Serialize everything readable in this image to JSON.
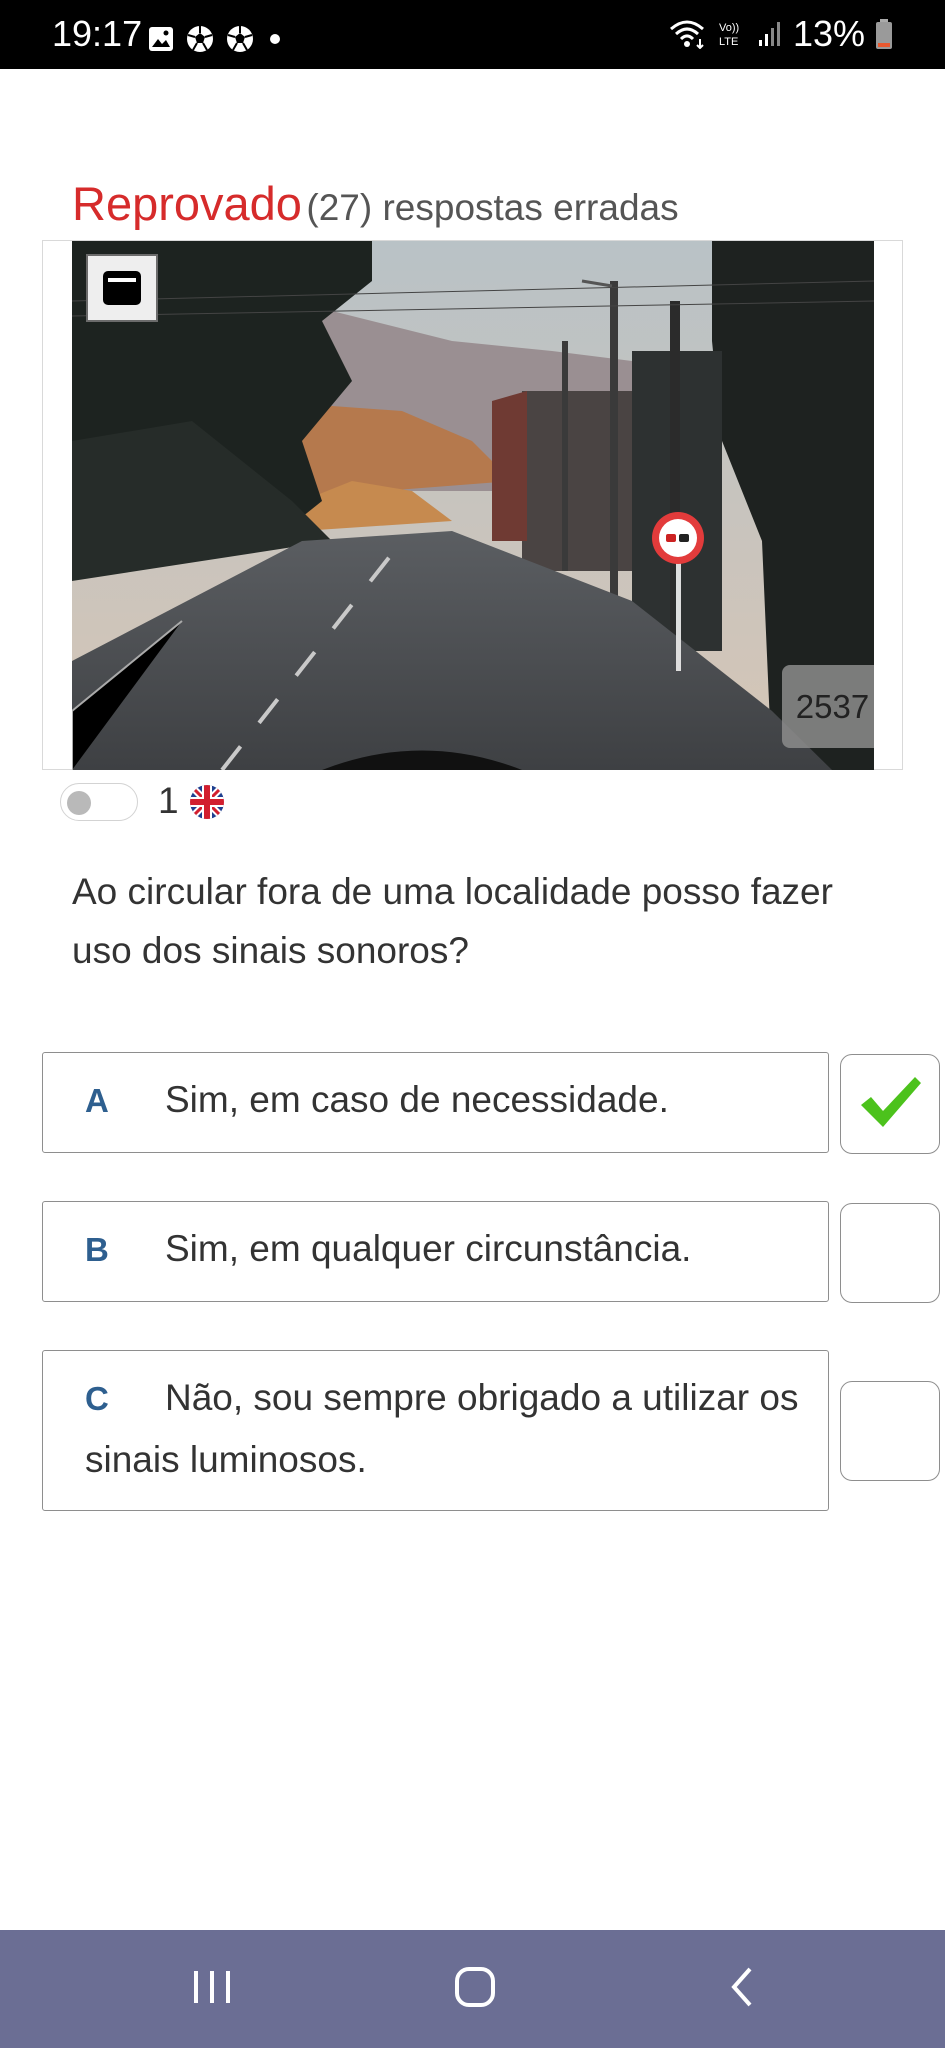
{
  "status_bar": {
    "time": "19:17",
    "left_icons": [
      "gallery-icon",
      "soccer-ball-icon",
      "soccer-ball-icon",
      "notification-dot-icon"
    ],
    "right_icons": [
      "wifi-icon",
      "volte-icon",
      "signal-icon",
      "battery-icon"
    ],
    "volte_label": "Vo))\nLTE",
    "battery_percent": "13%",
    "battery_level": 0.13
  },
  "result": {
    "status": "Reprovado",
    "detail": "(27) respostas erradas"
  },
  "image": {
    "id_badge": "2537",
    "expand_icon": "expand-icon"
  },
  "question": {
    "number": "1",
    "flag_icon": "uk-flag-icon",
    "text": "Ao circular fora de uma localidade posso fazer uso dos sinais sonoros?"
  },
  "answers": [
    {
      "letter": "A",
      "text": "Sim, em caso de necessidade.",
      "checked": true
    },
    {
      "letter": "B",
      "text": "Sim, em qualquer circunstância.",
      "checked": false
    },
    {
      "letter": "C",
      "text": "Não, sou sempre obrigado a utilizar os sinais luminosos.",
      "checked": false
    }
  ],
  "colors": {
    "status_red": "#d62b2b",
    "letter_blue": "#2e5f8f",
    "check_green": "#4cc21c",
    "navbar": "#6b6e94"
  },
  "nav": {
    "icons": [
      "recent-apps-icon",
      "home-icon",
      "back-icon"
    ]
  }
}
